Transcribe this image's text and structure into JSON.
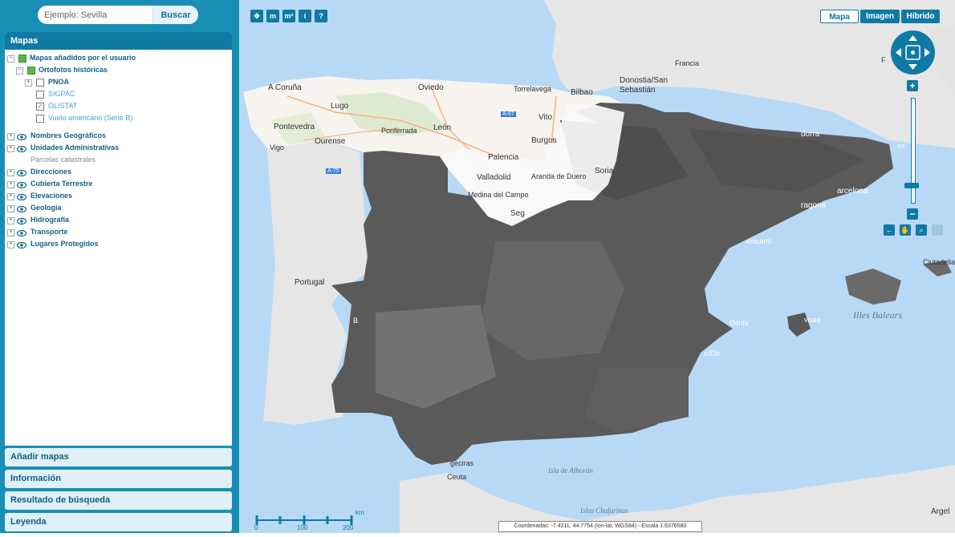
{
  "search": {
    "placeholder": "Ejemplo: Sevilla",
    "button": "Buscar"
  },
  "panel": {
    "title": "Mapas",
    "tree": {
      "user_maps": "Mapas añadidos por el usuario",
      "historical": "Ortofotos históricas",
      "pnoa": "PNOA",
      "sigpac": "SIGPAC",
      "olistat": "OLISTAT",
      "vuelo": "Vuelo americano (Serie B)",
      "layers": [
        {
          "label": "Nombres Geográficos"
        },
        {
          "label": "Unidades Administrativas"
        },
        {
          "label": "Parcelas catastrales"
        },
        {
          "label": "Direcciones"
        },
        {
          "label": "Cubierta Terrestre"
        },
        {
          "label": "Elevaciones"
        },
        {
          "label": "Geología"
        },
        {
          "label": "Hidrografía"
        },
        {
          "label": "Transporte"
        },
        {
          "label": "Lugares Protegidos"
        }
      ]
    },
    "sections": [
      "Añadir mapas",
      "Información",
      "Resultado de búsqueda",
      "Leyenda"
    ]
  },
  "maptype": {
    "mapa": "Mapa",
    "imagen": "Imagen",
    "hibrido": "Híbrido"
  },
  "map_labels": {
    "francia": "Francia",
    "a_coruna": "A Coruña",
    "oviedo": "Oviedo",
    "torrelavega": "Torrelavega",
    "bilbao": "Bilbao",
    "donostia": "Donostia/San",
    "sebastian": "Sebastián",
    "lugo": "Lugo",
    "pontevedra": "Pontevedra",
    "ponferrada": "Ponferrada",
    "leon": "León",
    "vigo": "Vigo",
    "ourense": "Ourense",
    "burgos": "Burgos",
    "palencia": "Palencia",
    "valladolid": "Valladolid",
    "aranda": "Aranda de Duero",
    "soria": "Soria",
    "medina": "Medina del Campo",
    "segovia": "Seg",
    "vito": "Vito",
    "andorra": "dorra",
    "portugal": "Portugal",
    "barcelona": "arcelona",
    "tarragona": "ragona",
    "gerona": "ns",
    "benicarlo": "enicarló",
    "denia": "Dénia",
    "elx": "e/Elx",
    "eivissa": "vissa",
    "illes_balears": "Illes Balears",
    "ciutadella": "Ciutadella",
    "ceuta": "Ceuta",
    "algeciras": "geciras",
    "alboran": "Isla de Alborán",
    "chafarinas": "Islas Chafarinas",
    "argel": "Argel",
    "fr": "F",
    "a67": "A-67",
    "a75": "A-75",
    "b": "B"
  },
  "scale": {
    "zero": "0",
    "mid": "100",
    "max": "200",
    "unit": "km"
  },
  "coords": "Coordenadas: -7.4211, 44.7754 (lon-lat, WGS84) - Escala 1:6376580",
  "colors": {
    "brand": "#0f7aa4",
    "sidebar": "#1a8fb5",
    "sea": "#b8d9f5",
    "land": "#e6e6e6"
  }
}
